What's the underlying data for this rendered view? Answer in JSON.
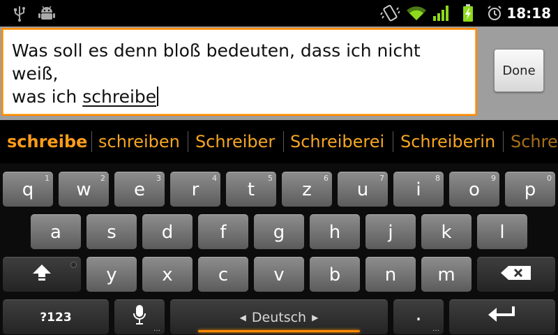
{
  "status_bar": {
    "icons": [
      "usb-icon",
      "android-debug-icon",
      "vibrate-icon",
      "wifi-icon",
      "signal-icon",
      "battery-charging-icon",
      "alarm-icon"
    ],
    "time": "18:18"
  },
  "editor": {
    "text_line1": "Was soll es denn bloß bedeuten, dass ich nicht weiß,",
    "text_prefix": "was ich ",
    "composing_word": "schreibe",
    "done_label": "Done",
    "accent_color": "#ff8a00"
  },
  "suggestions": [
    "schreibe",
    "schreiben",
    "Schreiber",
    "Schreiberei",
    "Schreiberin",
    "Schre"
  ],
  "keyboard": {
    "row1": [
      {
        "label": "q",
        "hint": "1"
      },
      {
        "label": "w",
        "hint": "2"
      },
      {
        "label": "e",
        "hint": "3"
      },
      {
        "label": "r",
        "hint": "4"
      },
      {
        "label": "t",
        "hint": "5"
      },
      {
        "label": "z",
        "hint": "6"
      },
      {
        "label": "u",
        "hint": "7"
      },
      {
        "label": "i",
        "hint": "8"
      },
      {
        "label": "o",
        "hint": "9"
      },
      {
        "label": "p",
        "hint": "0"
      }
    ],
    "row2": [
      "a",
      "s",
      "d",
      "f",
      "g",
      "h",
      "j",
      "k",
      "l"
    ],
    "row3": [
      "y",
      "x",
      "c",
      "v",
      "b",
      "n",
      "m"
    ],
    "symbols_label": "?123",
    "space_label": "Deutsch",
    "period_label": ".",
    "more_dots": "…"
  }
}
